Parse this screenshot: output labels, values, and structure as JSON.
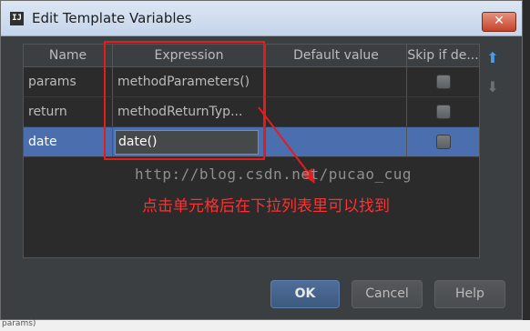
{
  "window": {
    "title": "Edit Template Variables",
    "icon_text": "IJ"
  },
  "table": {
    "columns": [
      "Name",
      "Expression",
      "Default value",
      "Skip if de..."
    ],
    "rows": [
      {
        "name": "params",
        "expression": "methodParameters()",
        "default": "",
        "skip": false
      },
      {
        "name": "return",
        "expression": "methodReturnTyp...",
        "default": "",
        "skip": false
      },
      {
        "name": "date",
        "expression": "date()",
        "default": "",
        "skip": false,
        "selected": true
      }
    ]
  },
  "side_icons": [
    "move-up-arrow",
    "move-down-arrow"
  ],
  "buttons": {
    "ok": "OK",
    "cancel": "Cancel",
    "help": "Help"
  },
  "annotation": {
    "watermark": "http://blog.csdn.net/pucao_cug",
    "note": "点击单元格后在下拉列表里可以找到",
    "color": "#e51c1c"
  },
  "background_text": "params)",
  "colors": {
    "selection": "#4b6eaf",
    "dialog_bg": "#3c3f41"
  }
}
